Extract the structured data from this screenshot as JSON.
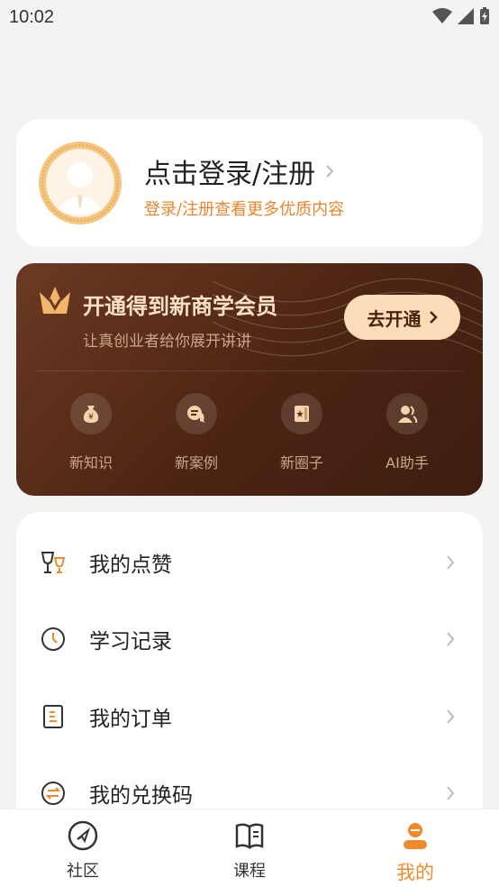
{
  "status_bar": {
    "time": "10:02"
  },
  "profile": {
    "login_title": "点击登录/注册",
    "login_subtitle": "登录/注册查看更多优质内容"
  },
  "vip": {
    "title": "开通得到新商学会员",
    "subtitle": "让真创业者给你展开讲讲",
    "button_label": "去开通",
    "features": [
      {
        "label": "新知识",
        "icon": "money-bag-icon"
      },
      {
        "label": "新案例",
        "icon": "chat-bubble-icon"
      },
      {
        "label": "新圈子",
        "icon": "card-star-icon"
      },
      {
        "label": "AI助手",
        "icon": "assistant-icon"
      }
    ]
  },
  "menu": {
    "items": [
      {
        "label": "我的点赞",
        "icon": "trophy-like-icon"
      },
      {
        "label": "学习记录",
        "icon": "clock-icon"
      },
      {
        "label": "我的订单",
        "icon": "order-icon"
      },
      {
        "label": "我的兑换码",
        "icon": "exchange-icon"
      }
    ]
  },
  "tab_bar": {
    "tabs": [
      {
        "label": "社区",
        "icon": "compass-icon"
      },
      {
        "label": "课程",
        "icon": "book-icon"
      },
      {
        "label": "我的",
        "icon": "profile-icon",
        "active": true
      }
    ]
  },
  "colors": {
    "accent": "#f08a2a",
    "vip_bg": "#4c2413",
    "vip_button": "#fbdcb9",
    "vip_text": "#fbe1c3"
  }
}
